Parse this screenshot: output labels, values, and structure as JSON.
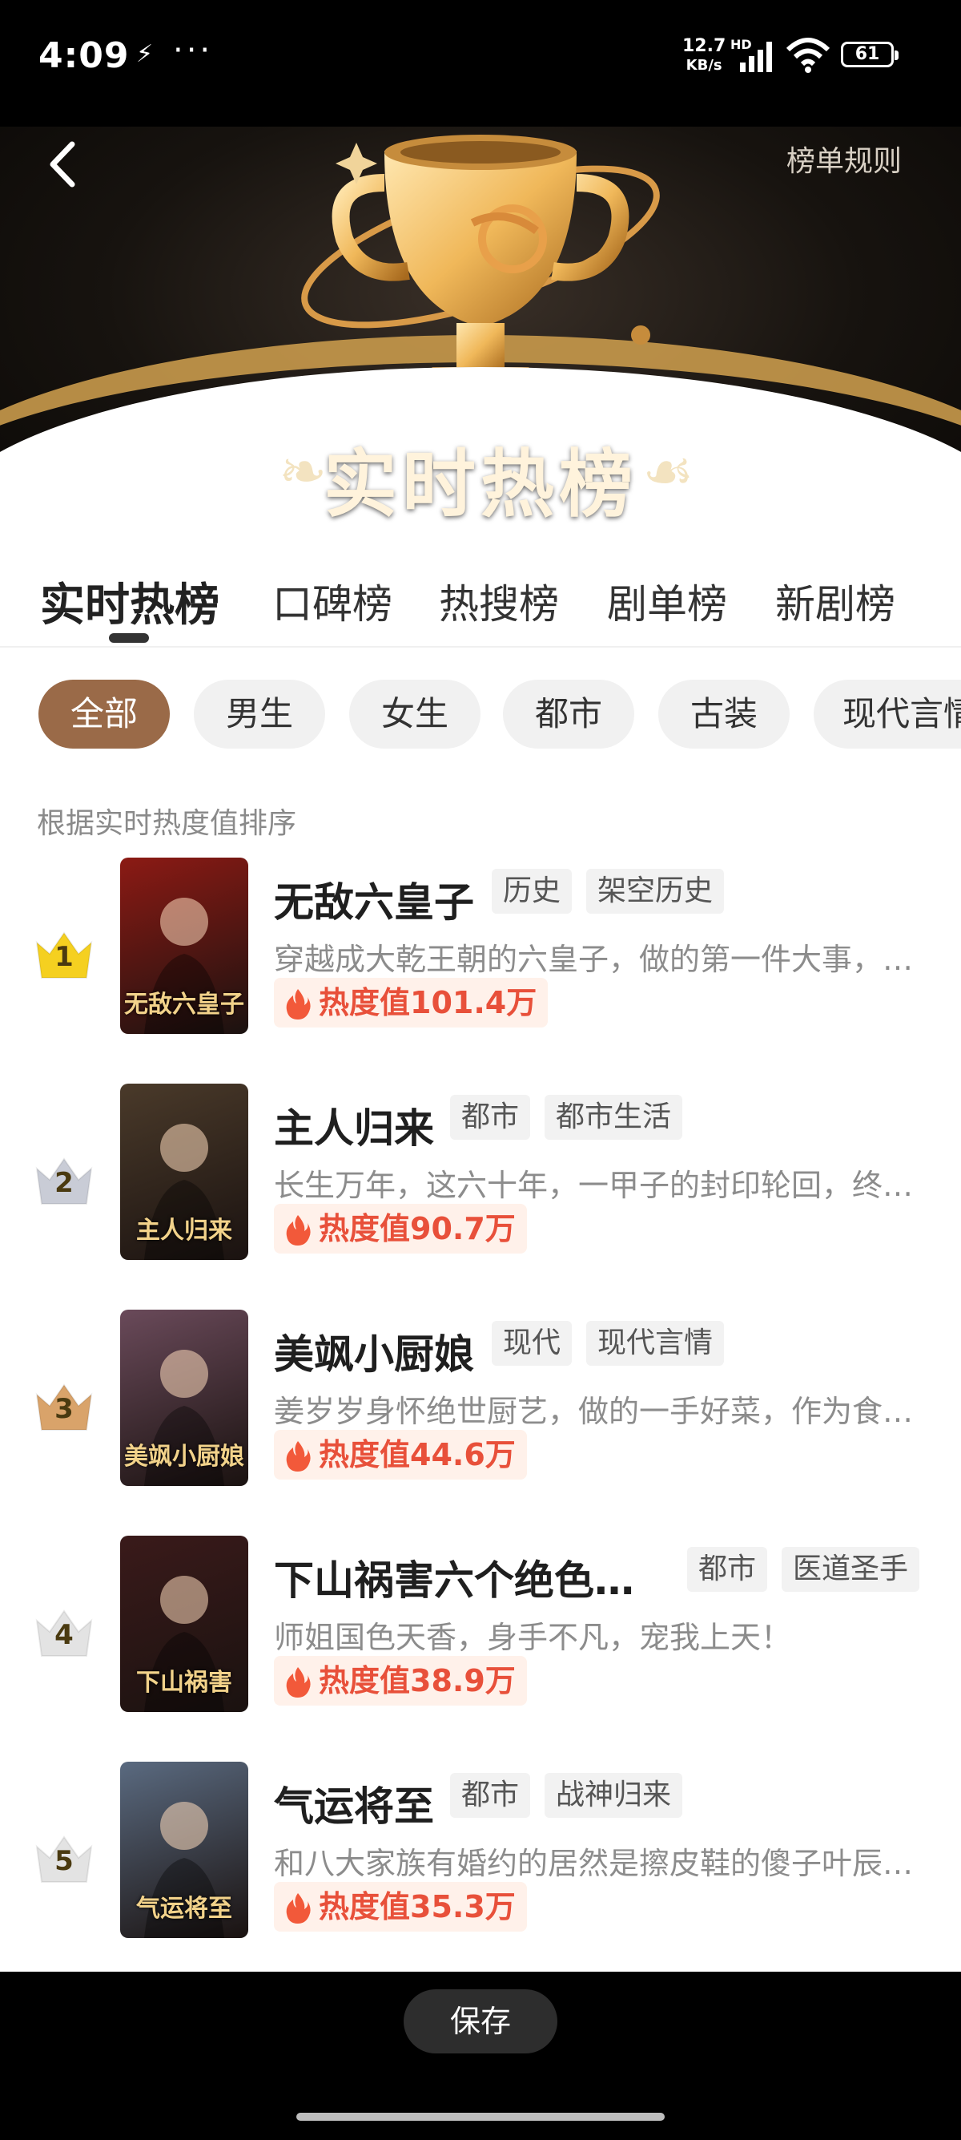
{
  "status_bar": {
    "time": "4:09",
    "extra_icons": "⚡",
    "more": "···",
    "net_speed_value": "12.7",
    "net_speed_unit": "KB/s",
    "hd_label": "HD",
    "battery": "61"
  },
  "header": {
    "rules_link": "榜单规则",
    "title": "实时热榜",
    "laurel_left": "❧",
    "laurel_right": "☙"
  },
  "tabs": [
    {
      "label": "实时热榜",
      "active": true
    },
    {
      "label": "口碑榜"
    },
    {
      "label": "热搜榜"
    },
    {
      "label": "剧单榜"
    },
    {
      "label": "新剧榜"
    }
  ],
  "filters": [
    {
      "label": "全部",
      "active": true
    },
    {
      "label": "男生"
    },
    {
      "label": "女生"
    },
    {
      "label": "都市"
    },
    {
      "label": "古装"
    },
    {
      "label": "现代言情"
    }
  ],
  "sort_hint": "根据实时热度值排序",
  "rankings": [
    {
      "rank": "1",
      "title": "无敌六皇子",
      "tags": [
        "历史",
        "架空历史"
      ],
      "description": "穿越成大乾王朝的六皇子，做的第一件大事，…",
      "heat": "热度值101.4万",
      "poster_text": "无敌六皇子",
      "crown_color": "#f5d020",
      "poster_color": "#8c1a14"
    },
    {
      "rank": "2",
      "title": "主人归来",
      "tags": [
        "都市",
        "都市生活"
      ],
      "description": "长生万年，这六十年，一甲子的封印轮回，终…",
      "heat": "热度值90.7万",
      "poster_text": "主人归来",
      "crown_color": "#c9ccd6",
      "poster_color": "#4a3a2a"
    },
    {
      "rank": "3",
      "title": "美飒小厨娘",
      "tags": [
        "现代",
        "现代言情"
      ],
      "description": "姜岁岁身怀绝世厨艺，做的一手好菜，作为食…",
      "heat": "热度值44.6万",
      "poster_text": "美飒小厨娘",
      "crown_color": "#d9a36a",
      "poster_color": "#6a4a5a"
    },
    {
      "rank": "4",
      "title": "下山祸害六个绝色…",
      "tags": [
        "都市",
        "医道圣手"
      ],
      "description": "师姐国色天香，身手不凡，宠我上天！",
      "heat": "热度值38.9万",
      "poster_text": "下山祸害",
      "crown_color": "#e3e3e3",
      "poster_color": "#3a1a1a"
    },
    {
      "rank": "5",
      "title": "气运将至",
      "tags": [
        "都市",
        "战神归来"
      ],
      "description": "和八大家族有婚约的居然是擦皮鞋的傻子叶辰…",
      "heat": "热度值35.3万",
      "poster_text": "气运将至",
      "crown_color": "#e3e3e3",
      "poster_color": "#5a6a80"
    }
  ],
  "bottom": {
    "save_button": "保存"
  }
}
